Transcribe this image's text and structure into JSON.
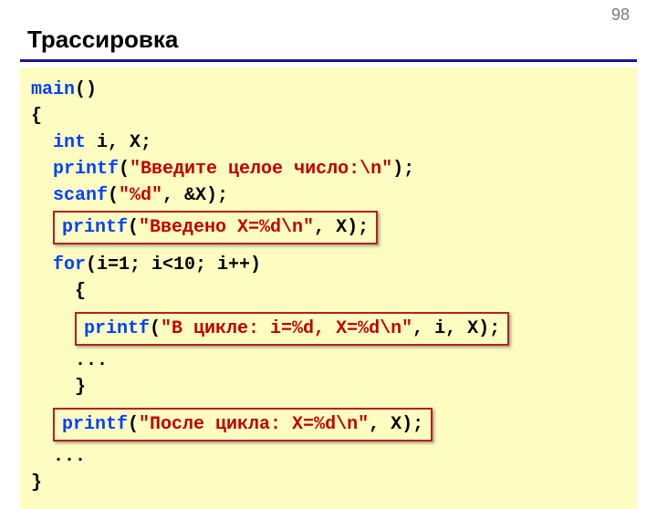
{
  "page_number": "98",
  "title": "Трассировка",
  "code": {
    "kw_main": "main",
    "main_suffix": "()",
    "brace_open": "{",
    "kw_int": "int",
    "decl_rest": " i, X;",
    "kw_printf": "printf",
    "lparen": "(",
    "rparen": ");",
    "str_prompt": "\"Введите целое число:\\n\"",
    "kw_scanf": "scanf",
    "str_scanf": "\"%d\"",
    "scanf_rest": ", &X);",
    "hl1_str": "\"Введено X=%d\\n\"",
    "hl1_rest": ", X);",
    "kw_for": "for",
    "for_rest": "(i=1; i<10; i++)",
    "inner_brace_open": "{",
    "hl2_str": "\"В цикле: i=%d, X=%d\\n\"",
    "hl2_rest": ", i, X);",
    "ellipsis": "...",
    "inner_brace_close": "}",
    "hl3_str": "\"После цикла: X=%d\\n\"",
    "hl3_rest": ", X);",
    "brace_close": "}"
  }
}
